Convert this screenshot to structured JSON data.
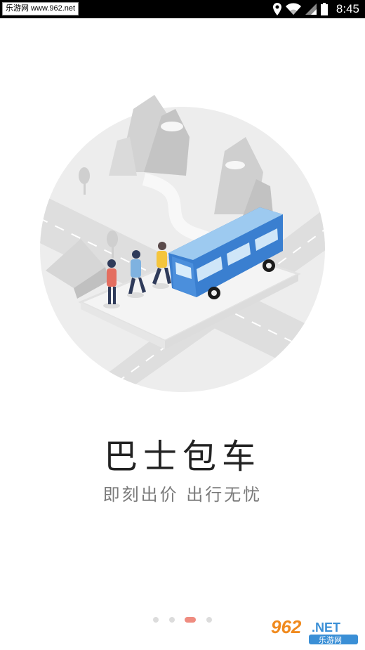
{
  "status_bar": {
    "watermark_text": "乐游网 www.962.net",
    "time": "8:45",
    "icons": [
      "location-icon",
      "wifi-icon",
      "signal-icon",
      "battery-icon"
    ]
  },
  "illustration": {
    "subject": "bus-charter-illustration"
  },
  "content": {
    "title": "巴士包车",
    "subtitle": "即刻出价 出行无忧"
  },
  "pager": {
    "count": 4,
    "active_index": 2,
    "active_color": "#ef8c80",
    "inactive_color": "#dcdcdc"
  },
  "watermark": {
    "brand": "962.NET",
    "brand_cn": "乐游网"
  },
  "colors": {
    "bus_blue": "#3a7fd0",
    "bus_light": "#8fc4ee",
    "circle_bg": "#eeeeee"
  }
}
